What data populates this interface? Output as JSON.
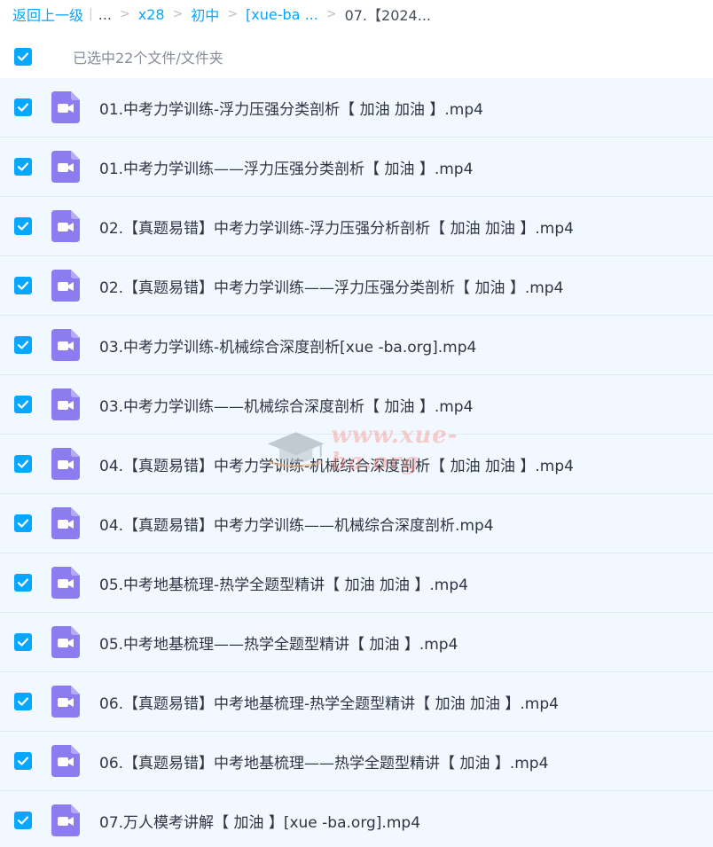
{
  "breadcrumb": {
    "back": "返回上一级",
    "separator": "|",
    "ellipsis": "...",
    "gt": ">",
    "items": [
      "x28",
      "初中",
      "[xue-ba ..."
    ],
    "current": "07.【2024..."
  },
  "selection": {
    "label": "已选中22个文件/文件夹",
    "checked": true
  },
  "files": [
    {
      "name": "01.中考力学训练-浮力压强分类剖析【 加油 加油 】.mp4",
      "checked": true
    },
    {
      "name": "01.中考力学训练——浮力压强分类剖析【 加油 】.mp4",
      "checked": true
    },
    {
      "name": "02.【真题易错】中考力学训练-浮力压强分析剖析【 加油 加油 】.mp4",
      "checked": true
    },
    {
      "name": "02.【真题易错】中考力学训练——浮力压强分类剖析【 加油 】.mp4",
      "checked": true
    },
    {
      "name": "03.中考力学训练-机械综合深度剖析[xue -ba.org].mp4",
      "checked": true
    },
    {
      "name": "03.中考力学训练——机械综合深度剖析【 加油 】.mp4",
      "checked": true
    },
    {
      "name": "04.【真题易错】中考力学训练-机械综合深度剖析【 加油 加油 】.mp4",
      "checked": true
    },
    {
      "name": "04.【真题易错】中考力学训练——机械综合深度剖析.mp4",
      "checked": true
    },
    {
      "name": "05.中考地基梳理-热学全题型精讲【 加油 加油 】.mp4",
      "checked": true
    },
    {
      "name": "05.中考地基梳理——热学全题型精讲【 加油 】.mp4",
      "checked": true
    },
    {
      "name": "06.【真题易错】中考地基梳理-热学全题型精讲【 加油 加油 】.mp4",
      "checked": true
    },
    {
      "name": "06.【真题易错】中考地基梳理——热学全题型精讲【 加油 】.mp4",
      "checked": true
    },
    {
      "name": "07.万人模考讲解【 加油 】[xue -ba.org].mp4",
      "checked": true
    }
  ],
  "watermark": {
    "text": "www.xue-ba.org",
    "icon": "graduation-cap-icon"
  },
  "colors": {
    "accent": "#06a7ff",
    "row_bg": "#f1f8ff",
    "video_icon": "#8c7cf0"
  }
}
